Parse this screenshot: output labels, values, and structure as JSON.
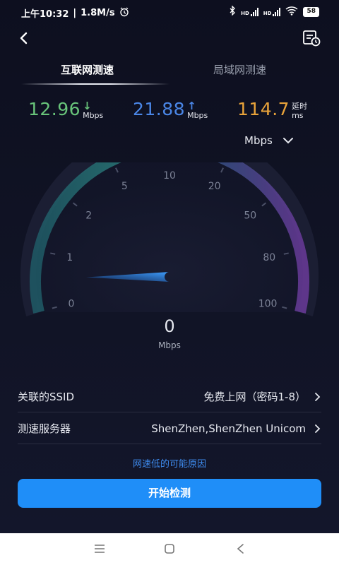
{
  "status_bar": {
    "time": "上午10:32",
    "net_speed": "1.8M/s",
    "sim1": "HD",
    "sim2": "HD",
    "battery": "58"
  },
  "icons": {
    "back": "back-chevron-icon",
    "history": "history-icon",
    "alarm": "alarm-icon",
    "bluetooth": "bluetooth-icon",
    "wifi": "wifi-icon",
    "unit_dropdown": "chevron-down-icon",
    "row_chevron": "chevron-right-icon"
  },
  "tabs": [
    {
      "label": "互联网测速",
      "active": true
    },
    {
      "label": "局域网测速",
      "active": false
    }
  ],
  "metrics": {
    "download": {
      "value": "12.96",
      "unit": "Mbps",
      "arrow": "↓",
      "color": "#68c47a"
    },
    "upload": {
      "value": "21.88",
      "unit": "Mbps",
      "arrow": "↑",
      "color": "#4a86e6"
    },
    "latency": {
      "value": "114.7",
      "label": "延时",
      "unit": "ms",
      "color": "#e8a33a"
    }
  },
  "unit_select": {
    "value": "Mbps"
  },
  "gauge": {
    "ticks": [
      "0",
      "1",
      "2",
      "5",
      "10",
      "20",
      "50",
      "80",
      "100"
    ],
    "current_speed": "0",
    "unit": "Mbps",
    "needle_fraction": 0.07
  },
  "info_rows": [
    {
      "label": "关联的SSID",
      "value": "免费上网（密码1-8）"
    },
    {
      "label": "测速服务器",
      "value": "ShenZhen,ShenZhen Unicom"
    }
  ],
  "reason_link": "网速低的可能原因",
  "start_button": "开始检测",
  "colors": {
    "background": "#0d0f1f",
    "accent": "#1f8ef8",
    "link": "#3e8cf0",
    "gauge_start": "#1f8a8a",
    "gauge_end": "#6a3a9a"
  }
}
